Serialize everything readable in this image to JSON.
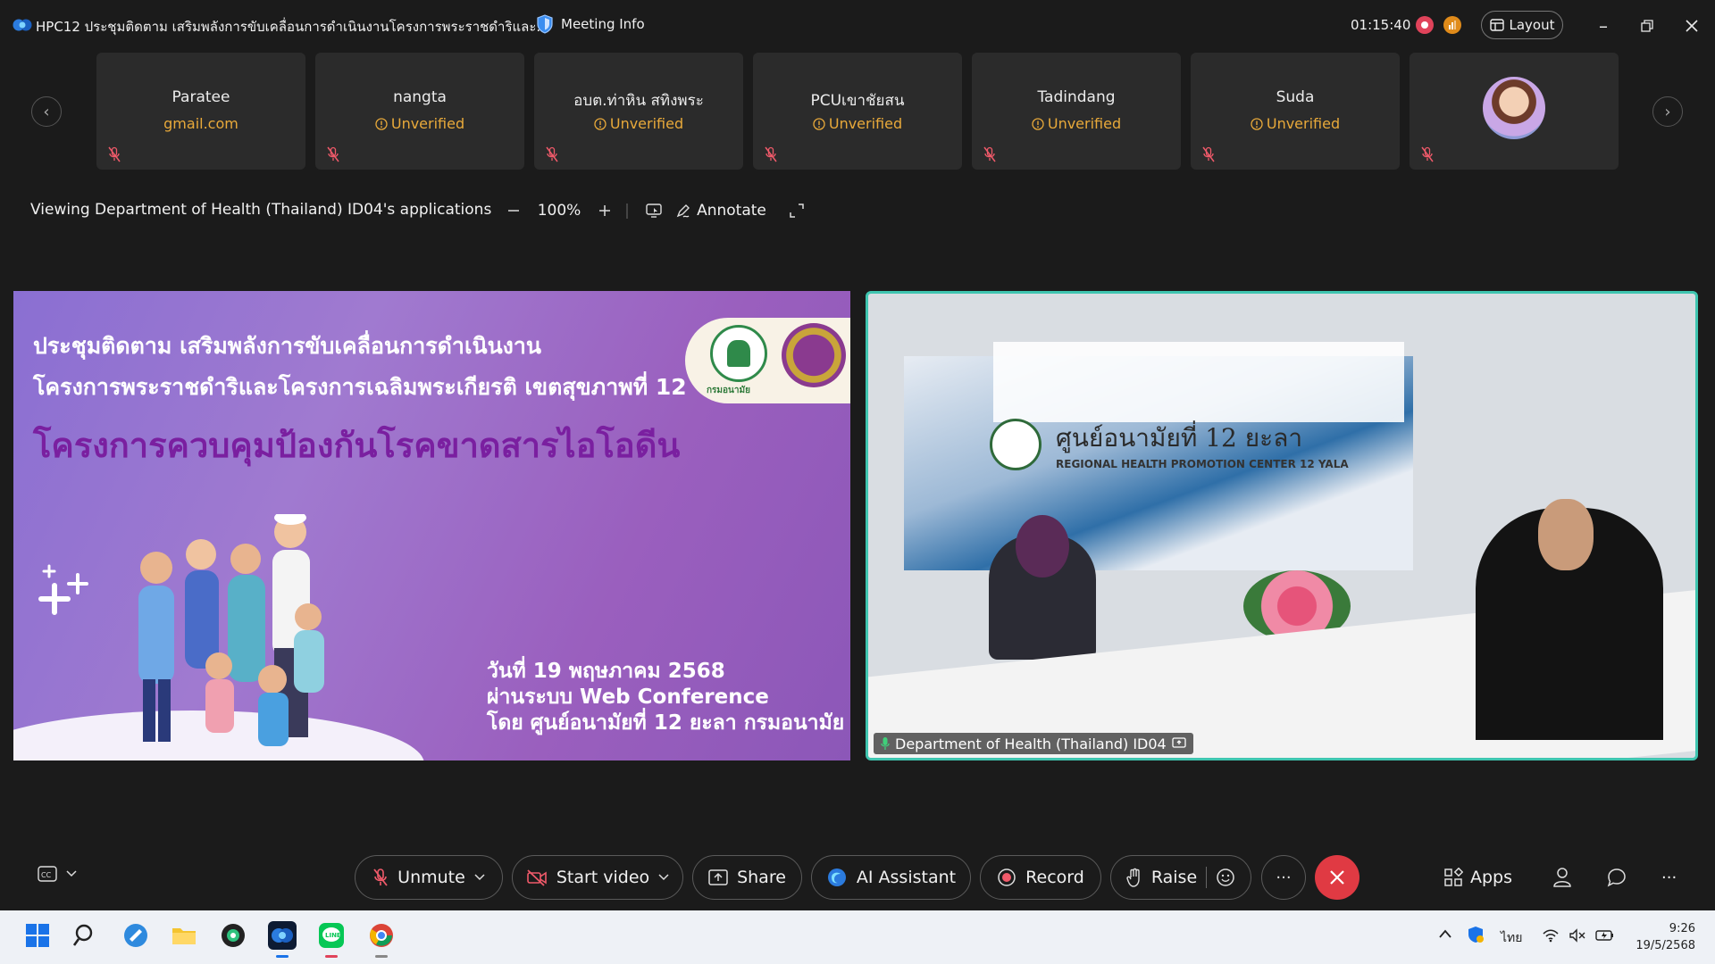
{
  "titlebar": {
    "title": "HPC12 ประชุมติดตาม เสริมพลังการขับเคลื่อนการดำเนินงานโครงการพระราชดำริและ...",
    "meeting_info": "Meeting Info",
    "timer": "01:15:40",
    "layout_label": "Layout",
    "colors": {
      "recording": "#e0435a",
      "network": "#e08b1a"
    }
  },
  "participants": [
    {
      "name": "Paratee",
      "sub": "gmail.com",
      "unverified": false,
      "has_photo": false
    },
    {
      "name": "nangta",
      "sub": "Unverified",
      "unverified": true,
      "has_photo": false
    },
    {
      "name": "อบต.ท่าหิน สทิงพระ",
      "sub": "Unverified",
      "unverified": true,
      "has_photo": false
    },
    {
      "name": "PCUเขาชัยสน",
      "sub": "Unverified",
      "unverified": true,
      "has_photo": false
    },
    {
      "name": "Tadindang",
      "sub": "Unverified",
      "unverified": true,
      "has_photo": false
    },
    {
      "name": "Suda",
      "sub": "Unverified",
      "unverified": true,
      "has_photo": false
    },
    {
      "name": "",
      "sub": "",
      "unverified": false,
      "has_photo": true
    }
  ],
  "viewing": {
    "text": "Viewing Department of Health (Thailand) ID04's applications",
    "zoom": "100%",
    "annotate": "Annotate"
  },
  "slide": {
    "line1": "ประชุมติดตาม เสริมพลังการขับเคลื่อนการดำเนินงาน",
    "line2": "โครงการพระราชดำริและโครงการเฉลิมพระเกียรติ เขตสุขภาพที่ 12",
    "headline": "โครงการควบคุมป้องกันโรคขาดสารไอโอดีน",
    "logo_caption": "กรมอนามัย",
    "date_line1": "วันที่ 19 พฤษภาคม 2568",
    "date_line2": "ผ่านระบบ Web Conference",
    "date_line3": "โดย ศูนย์อนามัยที่ 12 ยะลา กรมอนามัย"
  },
  "video": {
    "sign_th": "ศูนย์อนามัยที่ 12 ยะลา",
    "sign_en": "REGIONAL HEALTH PROMOTION CENTER 12 YALA",
    "label": "Department of Health (Thailand) ID04",
    "border_color": "#3fc5b0"
  },
  "toolbar": {
    "unmute": "Unmute",
    "start_video": "Start video",
    "share": "Share",
    "ai_assistant": "AI Assistant",
    "record": "Record",
    "raise": "Raise",
    "more": "···",
    "apps": "Apps",
    "end_color": "#e03a43"
  },
  "taskbar": {
    "language": "ไทย",
    "time": "9:26",
    "date": "19/5/2568"
  }
}
